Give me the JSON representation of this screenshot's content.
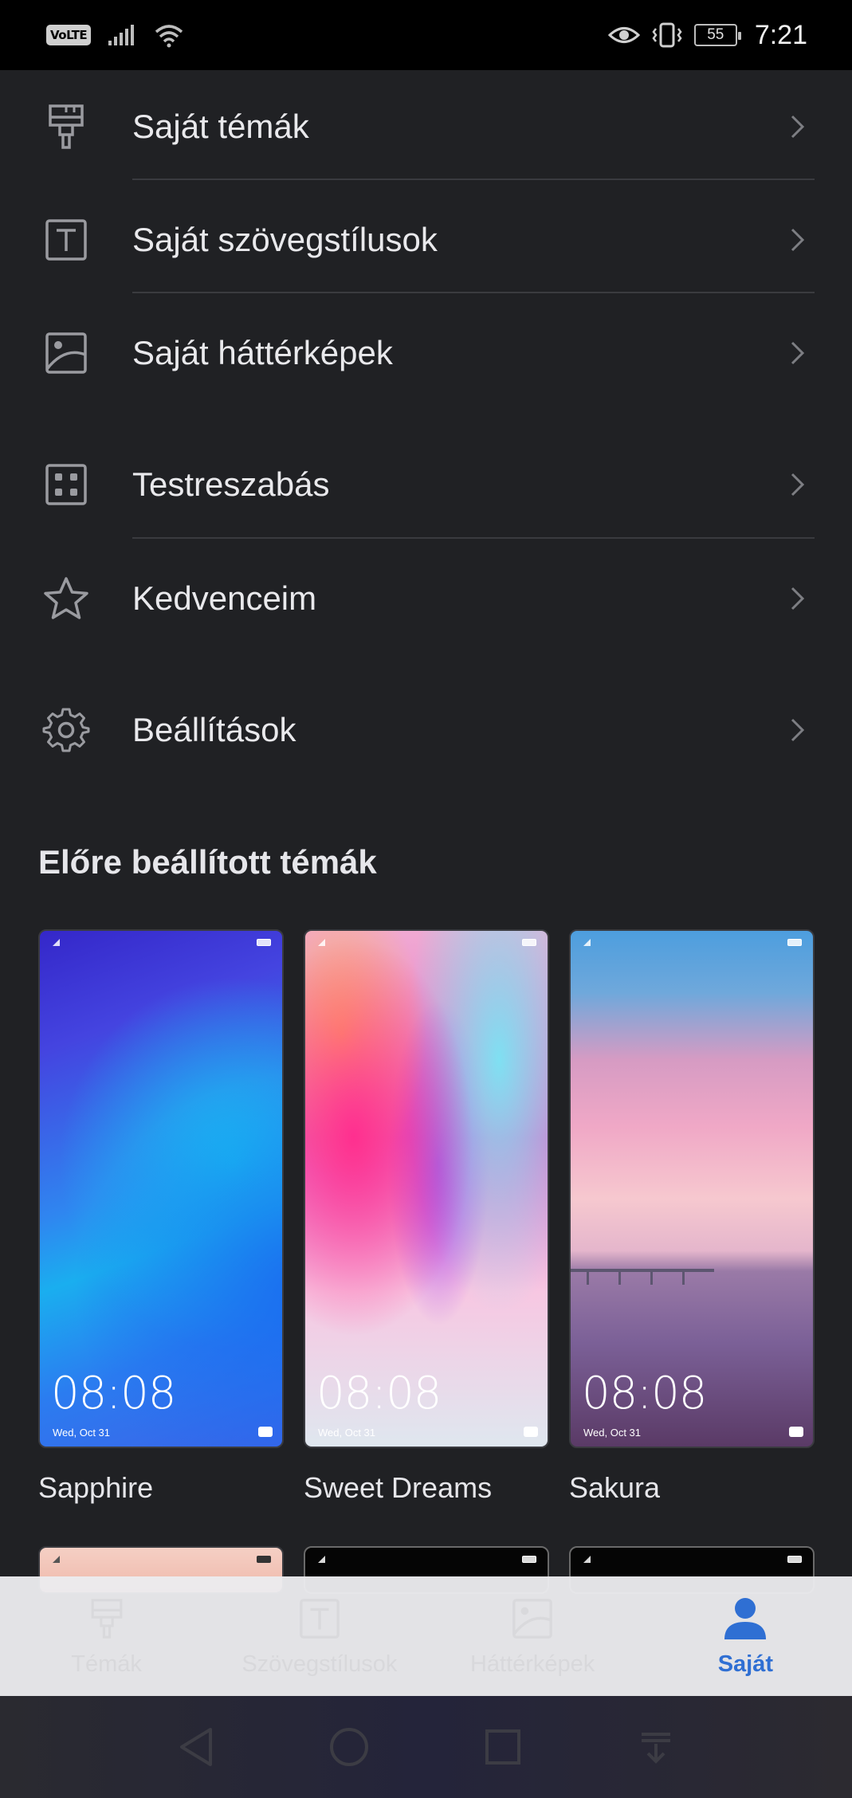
{
  "status_bar": {
    "volte": "VoLTE",
    "battery": "55",
    "time": "7:21"
  },
  "menu": {
    "items": [
      {
        "label": "Saját témák",
        "icon": "paint-roller-icon"
      },
      {
        "label": "Saját szövegstílusok",
        "icon": "text-box-icon"
      },
      {
        "label": "Saját háttérképek",
        "icon": "picture-icon"
      },
      {
        "label": "Testreszabás",
        "icon": "grid-customize-icon"
      },
      {
        "label": "Kedvenceim",
        "icon": "star-icon"
      },
      {
        "label": "Beállítások",
        "icon": "gear-icon"
      }
    ]
  },
  "presets": {
    "title": "Előre beállított témák",
    "themes": [
      {
        "name": "Sapphire",
        "time": "08:08",
        "date": "Wed, Oct 31"
      },
      {
        "name": "Sweet Dreams",
        "time": "08:08",
        "date": "Wed, Oct 31"
      },
      {
        "name": "Sakura",
        "time": "08:08",
        "date": "Wed, Oct 31"
      }
    ]
  },
  "bottom_nav": {
    "tabs": [
      {
        "label": "Témák",
        "icon": "paint-roller-icon"
      },
      {
        "label": "Szövegstílusok",
        "icon": "text-box-icon"
      },
      {
        "label": "Háttérképek",
        "icon": "picture-icon"
      },
      {
        "label": "Saját",
        "icon": "person-icon"
      }
    ],
    "active_color": "#2f6fd3"
  },
  "system_nav": {
    "buttons": [
      "back-icon",
      "home-icon",
      "recents-icon",
      "notification-pull-icon"
    ]
  }
}
